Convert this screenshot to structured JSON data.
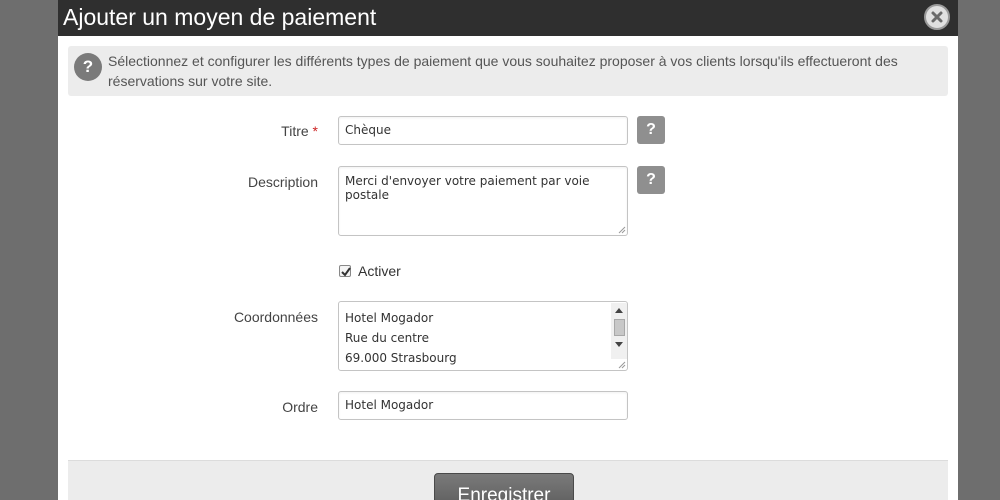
{
  "modal": {
    "title": "Ajouter un moyen de paiement",
    "info_text": "Sélectionnez et configurer les différents types de paiement que vous souhaitez proposer à vos clients lorsqu'ils effectueront des réservations sur votre site.",
    "info_icon_glyph": "?"
  },
  "form": {
    "titre": {
      "label": "Titre",
      "required_mark": "*",
      "value": "Chèque"
    },
    "description": {
      "label": "Description",
      "value": "Merci d'envoyer votre paiement par voie postale"
    },
    "activer": {
      "label": "Activer",
      "checked": true
    },
    "coordonnees": {
      "label": "Coordonnées",
      "lines": [
        "Hotel Mogador",
        "Rue du centre",
        "69.000 Strasbourg"
      ]
    },
    "ordre": {
      "label": "Ordre",
      "value": "Hotel Mogador"
    },
    "help_glyph": "?"
  },
  "footer": {
    "save_label": "Enregistrer"
  },
  "colors": {
    "header_bg": "#2f2f2f",
    "backdrop": "#6e6e6e",
    "info_bg": "#ececec",
    "help_btn": "#8f8f8f",
    "required": "#cc2222"
  },
  "icons": {
    "close": "close-circle-icon",
    "info": "question-circle-icon",
    "help": "question-icon"
  }
}
